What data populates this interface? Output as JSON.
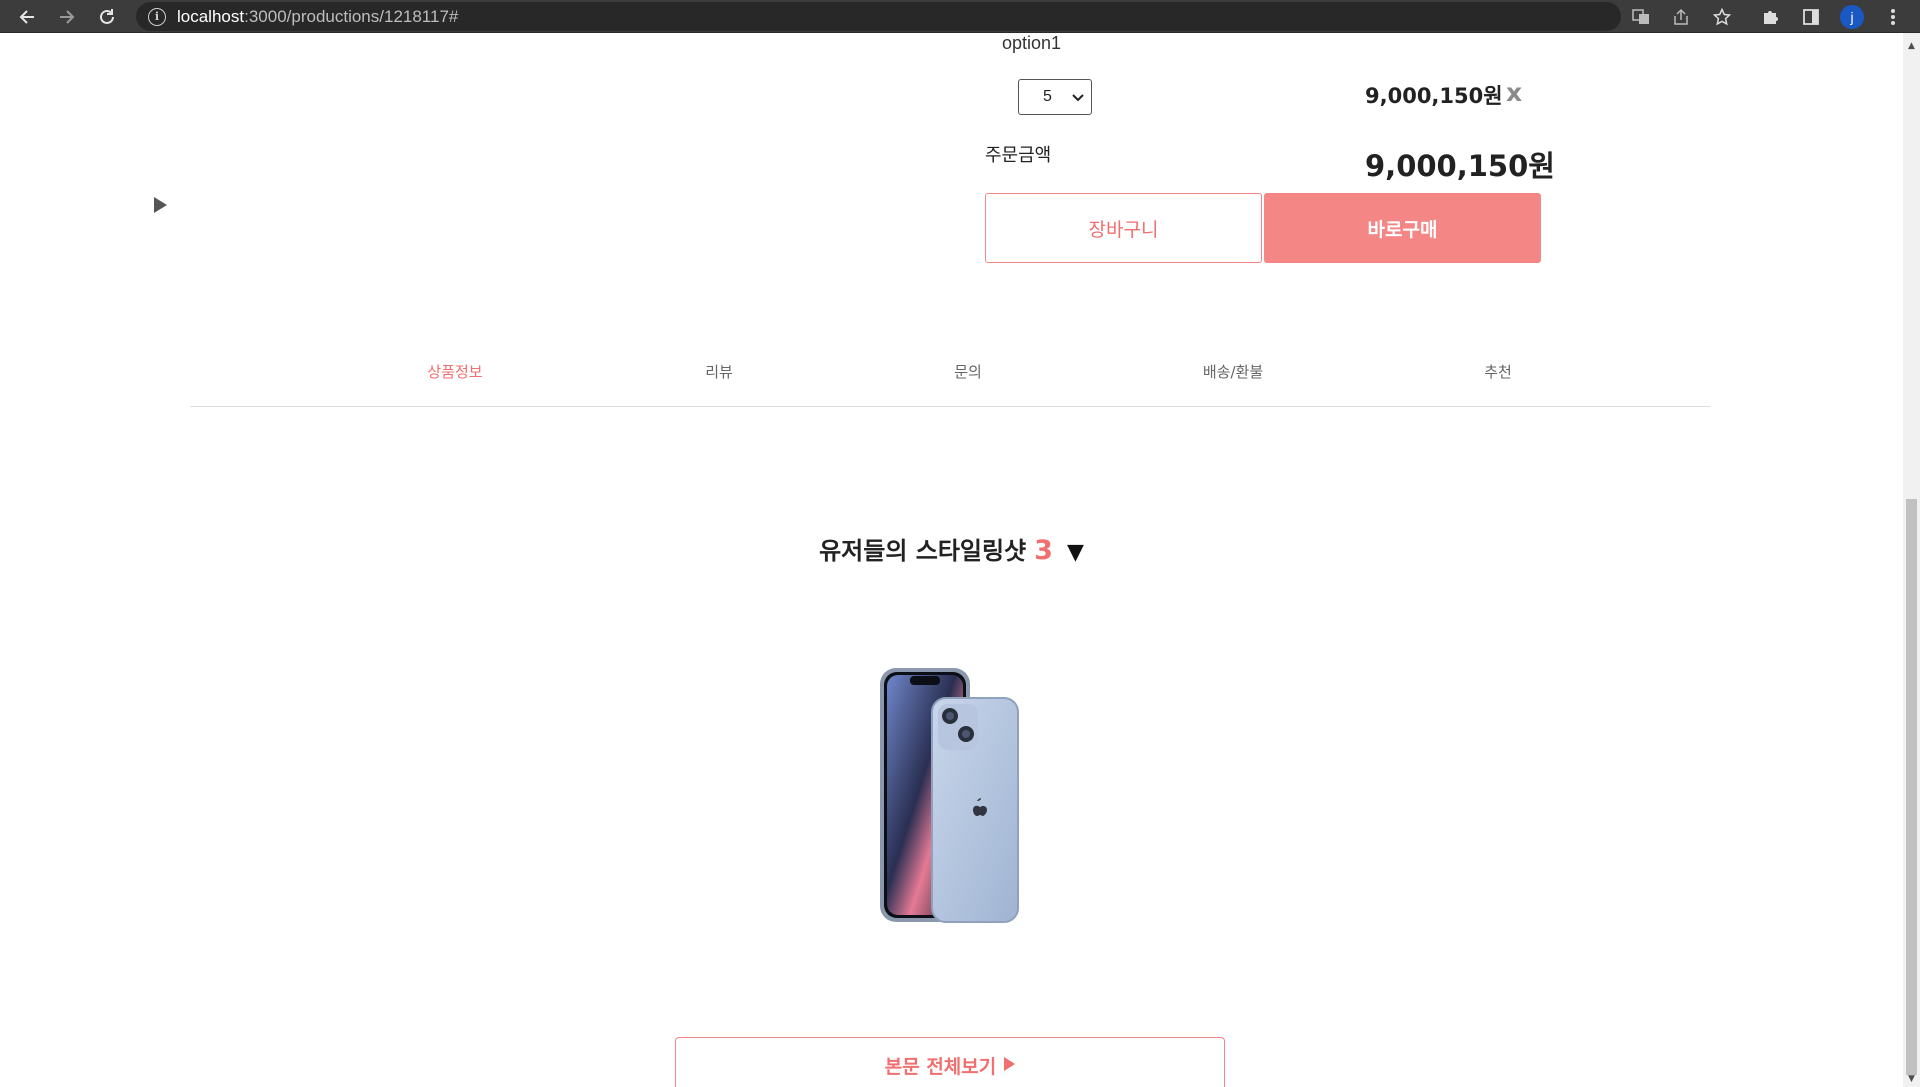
{
  "browser": {
    "url_host": "localhost",
    "url_path": ":3000/productions/1218117#",
    "profile_initial": "j"
  },
  "option": {
    "label": "option1",
    "quantity_selected": "5",
    "item_price": "9,000,150원",
    "remove_label": "x"
  },
  "order": {
    "total_label": "주문금액",
    "total_value": "9,000,150원"
  },
  "buttons": {
    "cart": "장바구니",
    "buy_now": "바로구매",
    "read_more": "본문 전체보기"
  },
  "tabs": [
    {
      "label": "상품정보",
      "active": true
    },
    {
      "label": "리뷰",
      "active": false
    },
    {
      "label": "문의",
      "active": false
    },
    {
      "label": "배송/환불",
      "active": false
    },
    {
      "label": "추천",
      "active": false
    }
  ],
  "styling_shots": {
    "title": "유저들의 스타일링샷",
    "count": "3",
    "toggle": "▼"
  },
  "colors": {
    "accent": "#f48686",
    "accent_text": "#f06f6f",
    "chrome_bg": "#3c3c3c"
  }
}
